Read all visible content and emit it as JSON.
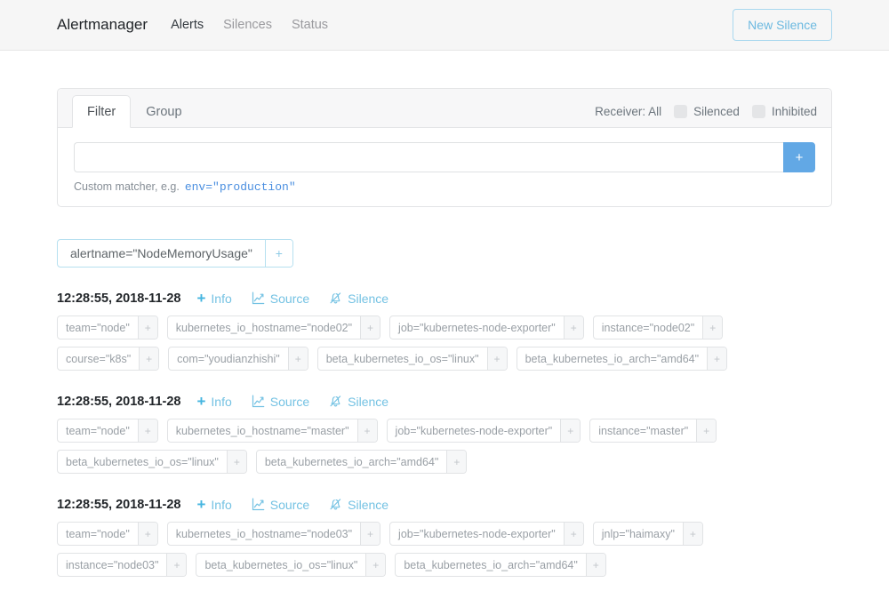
{
  "navbar": {
    "brand": "Alertmanager",
    "links": [
      {
        "label": "Alerts",
        "active": true
      },
      {
        "label": "Silences",
        "active": false
      },
      {
        "label": "Status",
        "active": false
      }
    ],
    "new_silence_label": "New Silence"
  },
  "filter_card": {
    "tabs": [
      {
        "label": "Filter",
        "active": true
      },
      {
        "label": "Group",
        "active": false
      }
    ],
    "receiver_label": "Receiver: All",
    "toggles": [
      {
        "label": "Silenced",
        "checked": false
      },
      {
        "label": "Inhibited",
        "checked": false
      }
    ],
    "matcher_input_value": "",
    "matcher_input_placeholder": "",
    "add_button_label": "+",
    "help_prefix": "Custom matcher, e.g.",
    "help_code": "env=\"production\""
  },
  "group_filter": {
    "label": "alertname=\"NodeMemoryUsage\"",
    "add_button_label": "+"
  },
  "alerts": [
    {
      "timestamp": "12:28:55, 2018-11-28",
      "actions": [
        {
          "label": "Info",
          "icon": "plus-icon"
        },
        {
          "label": "Source",
          "icon": "chart-line-icon"
        },
        {
          "label": "Silence",
          "icon": "bell-slash-icon"
        }
      ],
      "labels": [
        "team=\"node\"",
        "kubernetes_io_hostname=\"node02\"",
        "job=\"kubernetes-node-exporter\"",
        "instance=\"node02\"",
        "course=\"k8s\"",
        "com=\"youdianzhishi\"",
        "beta_kubernetes_io_os=\"linux\"",
        "beta_kubernetes_io_arch=\"amd64\""
      ]
    },
    {
      "timestamp": "12:28:55, 2018-11-28",
      "actions": [
        {
          "label": "Info",
          "icon": "plus-icon"
        },
        {
          "label": "Source",
          "icon": "chart-line-icon"
        },
        {
          "label": "Silence",
          "icon": "bell-slash-icon"
        }
      ],
      "labels": [
        "team=\"node\"",
        "kubernetes_io_hostname=\"master\"",
        "job=\"kubernetes-node-exporter\"",
        "instance=\"master\"",
        "beta_kubernetes_io_os=\"linux\"",
        "beta_kubernetes_io_arch=\"amd64\""
      ]
    },
    {
      "timestamp": "12:28:55, 2018-11-28",
      "actions": [
        {
          "label": "Info",
          "icon": "plus-icon"
        },
        {
          "label": "Source",
          "icon": "chart-line-icon"
        },
        {
          "label": "Silence",
          "icon": "bell-slash-icon"
        }
      ],
      "labels": [
        "team=\"node\"",
        "kubernetes_io_hostname=\"node03\"",
        "job=\"kubernetes-node-exporter\"",
        "jnlp=\"haimaxy\"",
        "instance=\"node03\"",
        "beta_kubernetes_io_os=\"linux\"",
        "beta_kubernetes_io_arch=\"amd64\""
      ]
    }
  ],
  "colors": {
    "accent_blue": "#62a8e5",
    "link_blue": "#74c2e3",
    "code_blue": "#4b8fe0",
    "navbar_bg": "#f6f6f6",
    "border": "#e3e4e6",
    "label_text": "#9aa0a6"
  }
}
